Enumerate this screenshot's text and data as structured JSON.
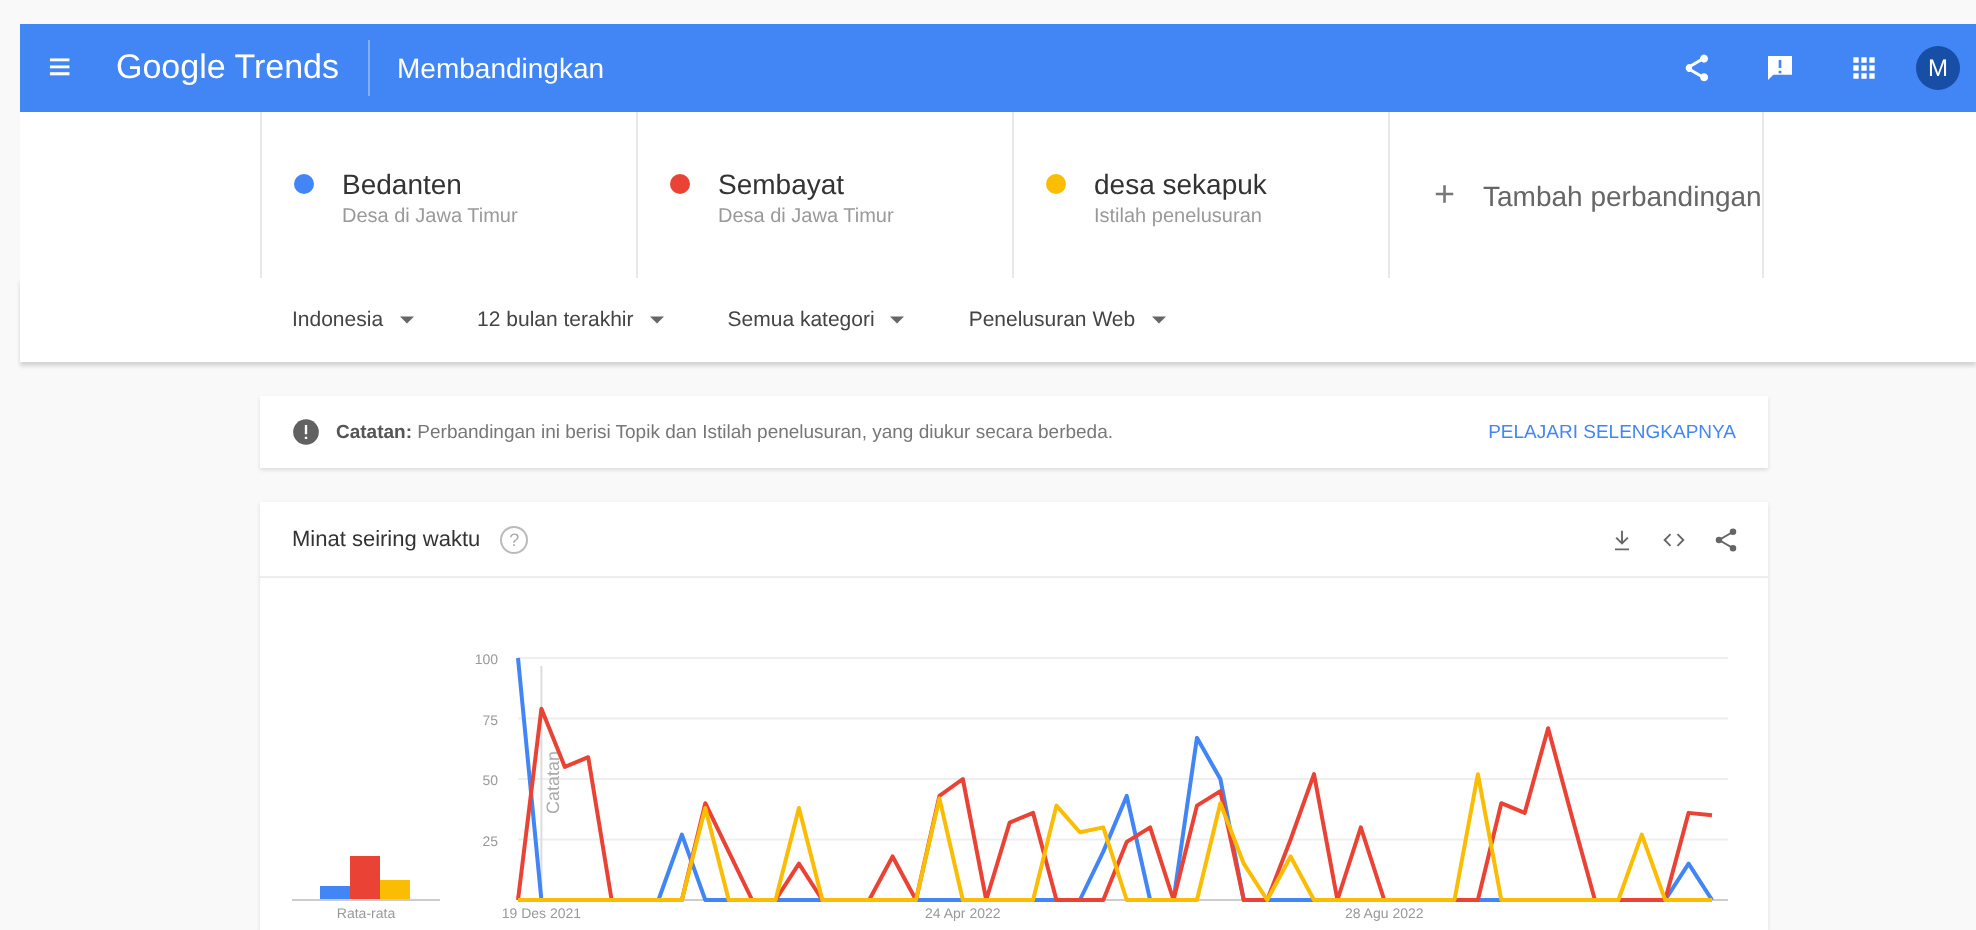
{
  "header": {
    "menu": "≡",
    "logo": "Google Trends",
    "title": "Membandingkan",
    "avatar": "M"
  },
  "terms": [
    {
      "name": "Bedanten",
      "subtitle": "Desa di Jawa Timur",
      "color": "#4285f4"
    },
    {
      "name": "Sembayat",
      "subtitle": "Desa di Jawa Timur",
      "color": "#ea4335"
    },
    {
      "name": "desa sekapuk",
      "subtitle": "Istilah penelusuran",
      "color": "#fbbc04"
    }
  ],
  "add_term": {
    "icon": "+",
    "label": "Tambah perbandingan"
  },
  "filters": [
    {
      "label": "Indonesia"
    },
    {
      "label": "12 bulan terakhir"
    },
    {
      "label": "Semua kategori"
    },
    {
      "label": "Penelusuran Web"
    }
  ],
  "note": {
    "text": "**Catatan:** Perbandingan ini berisi Topik dan Istilah penelusuran, yang diukur secara berbeda.",
    "link": "PELAJARI SELENGKAPNYA"
  },
  "interest": {
    "title": "Minat seiring waktu",
    "help": "?",
    "average_label": "Rata-rata",
    "chart_data": {
      "type": "line",
      "grid": true,
      "categories": [
        null,
        "19 Des 2021",
        null,
        null,
        null,
        null,
        null,
        null,
        null,
        null,
        null,
        null,
        null,
        null,
        null,
        null,
        null,
        null,
        null,
        "24 Apr 2022",
        null,
        null,
        null,
        null,
        null,
        null,
        null,
        null,
        null,
        null,
        null,
        null,
        null,
        null,
        null,
        null,
        null,
        "28 Agu 2022",
        null,
        null,
        null,
        null,
        null,
        null,
        null,
        null,
        null,
        null,
        null,
        null,
        null,
        null
      ],
      "yticks": [
        25,
        50,
        75,
        100
      ],
      "ylim": [
        0,
        100
      ],
      "annotations": [
        "Catatan"
      ],
      "series": [
        {
          "color": "#4285f4",
          "values": [
            100,
            0,
            0,
            0,
            0,
            0,
            0,
            27,
            0,
            0,
            0,
            0,
            0,
            0,
            0,
            0,
            0,
            0,
            0,
            0,
            0,
            0,
            0,
            0,
            0,
            20,
            43,
            0,
            0,
            67,
            50,
            0,
            0,
            0,
            0,
            0,
            0,
            0,
            0,
            0,
            0,
            0,
            0,
            0,
            0,
            0,
            0,
            0,
            0,
            0,
            15,
            0
          ]
        },
        {
          "color": "#ea4335",
          "values": [
            0,
            79,
            55,
            59,
            0,
            0,
            0,
            0,
            40,
            20,
            0,
            0,
            15,
            0,
            0,
            0,
            18,
            0,
            43,
            50,
            0,
            32,
            36,
            0,
            0,
            0,
            24,
            30,
            0,
            39,
            45,
            0,
            0,
            25,
            52,
            0,
            30,
            0,
            0,
            0,
            0,
            0,
            40,
            36,
            71,
            35,
            0,
            0,
            0,
            0,
            36,
            35
          ]
        },
        {
          "color": "#fbbc04",
          "values": [
            0,
            0,
            0,
            0,
            0,
            0,
            0,
            0,
            38,
            0,
            0,
            0,
            38,
            0,
            0,
            0,
            0,
            0,
            42,
            0,
            0,
            0,
            0,
            39,
            28,
            30,
            0,
            0,
            0,
            0,
            40,
            15,
            0,
            18,
            0,
            0,
            0,
            0,
            0,
            0,
            0,
            52,
            0,
            0,
            0,
            0,
            0,
            0,
            27,
            0,
            0,
            0
          ]
        }
      ]
    }
  }
}
